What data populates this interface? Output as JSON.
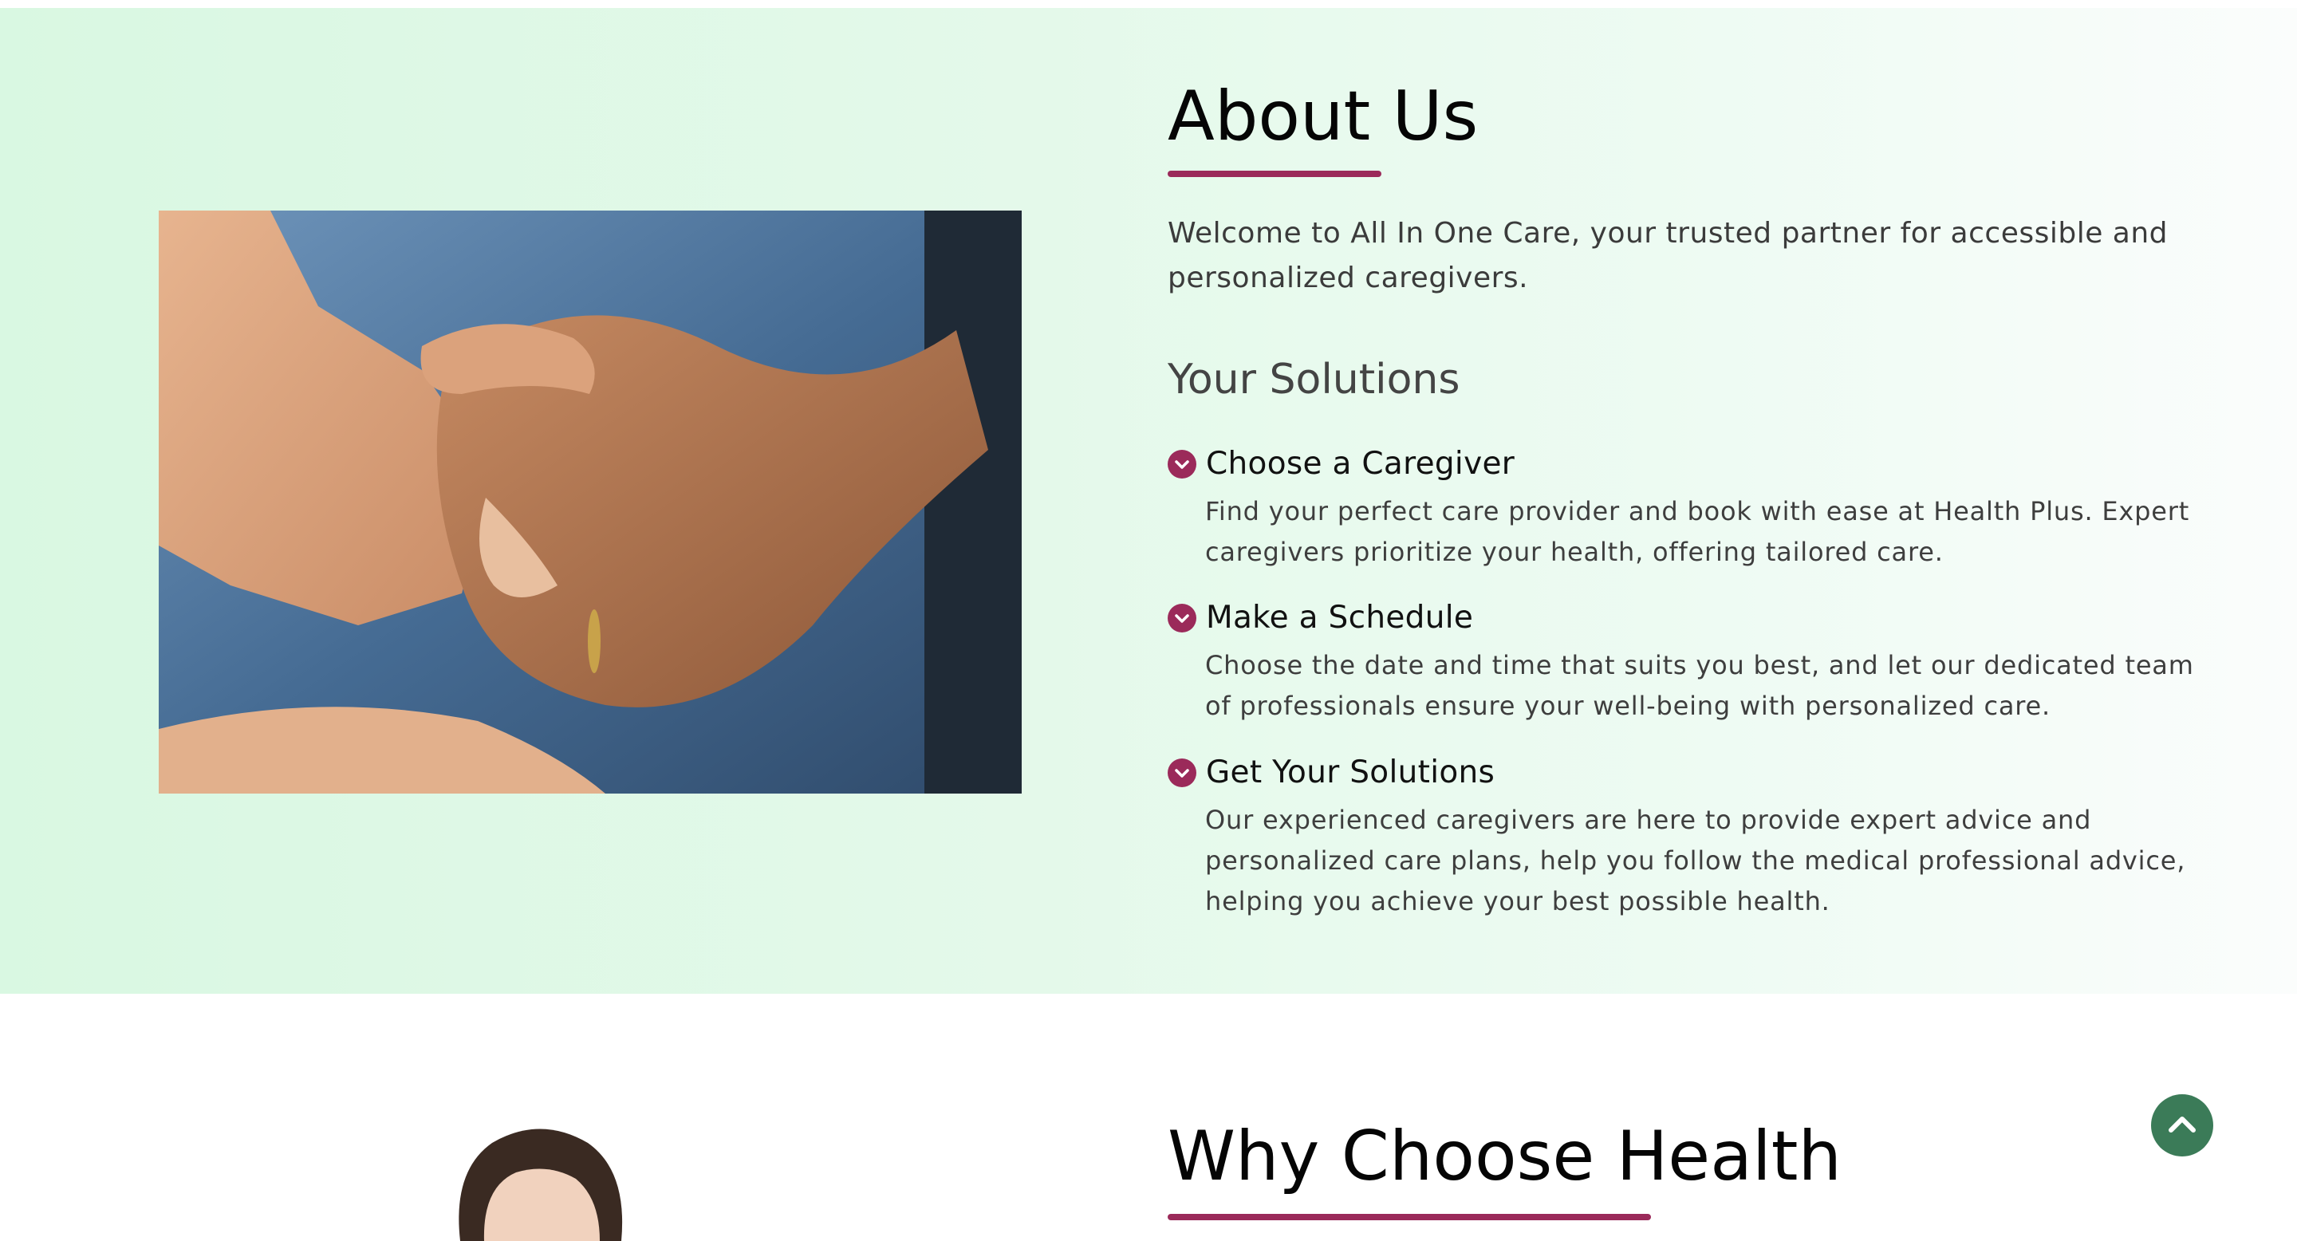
{
  "about": {
    "title": "About Us",
    "intro": "Welcome to All In One Care, your trusted partner for accessible and personalized caregivers.",
    "image_alt": "Two people holding hands",
    "solutions_heading": "Your Solutions",
    "solutions": [
      {
        "title": "Choose a Caregiver",
        "description": "Find your perfect care provider and book with ease at Health Plus. Expert caregivers prioritize your health, offering tailored care.",
        "icon": "chevron-down-circle-icon"
      },
      {
        "title": "Make a Schedule",
        "description": "Choose the date and time that suits you best, and let our dedicated team of professionals ensure your well-being with personalized care.",
        "icon": "chevron-down-circle-icon"
      },
      {
        "title": "Get Your Solutions",
        "description": "Our experienced caregivers are here to provide expert advice and personalized care plans, help you follow the medical professional advice, helping you achieve your best possible health.",
        "icon": "chevron-down-circle-icon"
      }
    ]
  },
  "why": {
    "title": "Why Choose Health"
  },
  "scroll_top": {
    "icon": "chevron-up-icon"
  },
  "colors": {
    "accent": "#9b2a5a",
    "scroll_button": "#3b7b58",
    "about_background": "#d9f8e2"
  }
}
